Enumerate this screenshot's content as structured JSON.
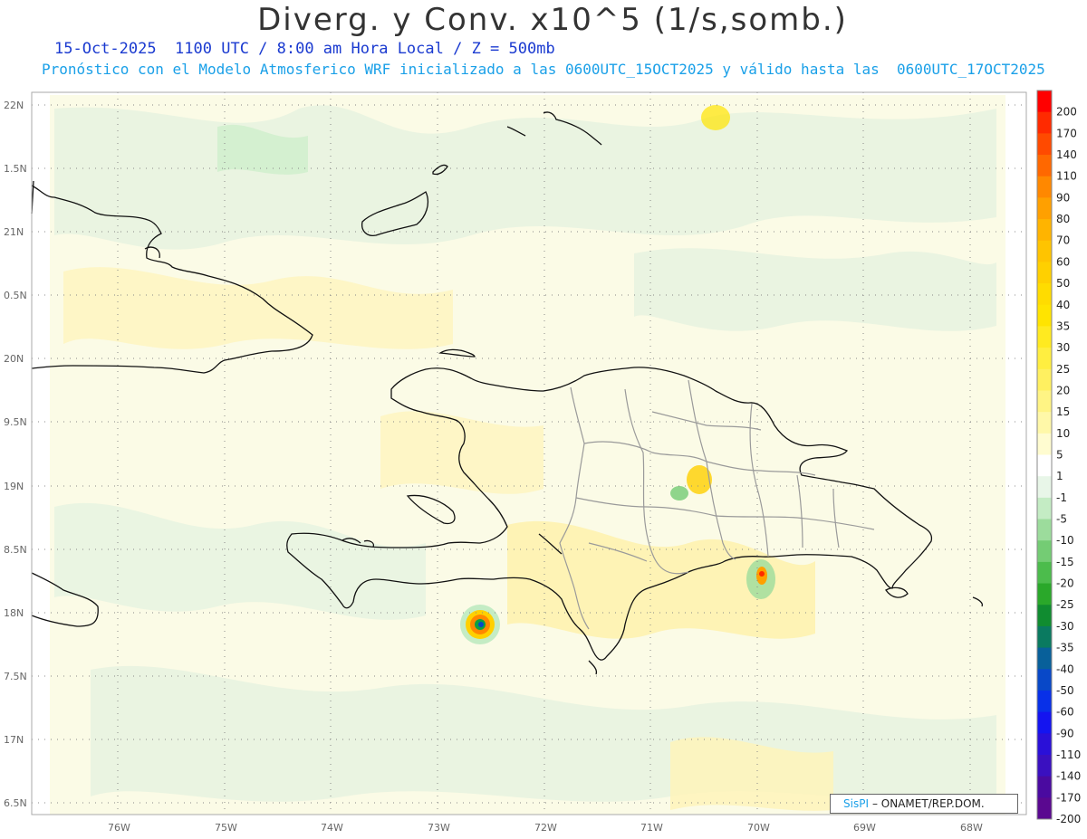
{
  "title": "Diverg. y Conv. x10^5 (1/s,somb.)",
  "subtitle_line1": "15-Oct-2025  1100 UTC / 8:00 am Hora Local / Z = 500mb",
  "subtitle_line2": "Pronóstico con el Modelo Atmosferico WRF inicializado a las 0600UTC_15OCT2025 y válido hasta las  0600UTC_17OCT2025",
  "credit": {
    "logo": "SisPI",
    "org": "– ONAMET/REP.DOM."
  },
  "lat_labels": [
    "22N",
    "1.5N",
    "21N",
    "0.5N",
    "20N",
    "9.5N",
    "19N",
    "8.5N",
    "18N",
    "7.5N",
    "17N",
    "6.5N"
  ],
  "lon_labels": [
    "76W",
    "75W",
    "74W",
    "73W",
    "72W",
    "71W",
    "70W",
    "69W",
    "68W"
  ],
  "colorbar": {
    "labels": [
      "200",
      "170",
      "140",
      "110",
      "90",
      "80",
      "70",
      "60",
      "50",
      "40",
      "35",
      "30",
      "25",
      "20",
      "15",
      "10",
      "5",
      "1",
      "-1",
      "-5",
      "-10",
      "-15",
      "-20",
      "-25",
      "-30",
      "-35",
      "-40",
      "-50",
      "-60",
      "-90",
      "-110",
      "-140",
      "-170",
      "-200"
    ],
    "colors": [
      "#ff0000",
      "#ff2a00",
      "#ff4a00",
      "#ff6800",
      "#ff8800",
      "#ffa000",
      "#ffb400",
      "#ffc400",
      "#ffd000",
      "#ffdc00",
      "#ffe400",
      "#ffea20",
      "#ffee40",
      "#fff060",
      "#fff484",
      "#fff8a8",
      "#fffcd0",
      "#ffffff",
      "#e8f6e8",
      "#c4ecc4",
      "#9cdc9c",
      "#74cc74",
      "#4cbc4c",
      "#2aa82a",
      "#108c30",
      "#0a7a60",
      "#08609a",
      "#0848c8",
      "#0830e8",
      "#1414f0",
      "#2a10d8",
      "#3a10c0",
      "#4a0aa0",
      "#5a0890"
    ]
  }
}
